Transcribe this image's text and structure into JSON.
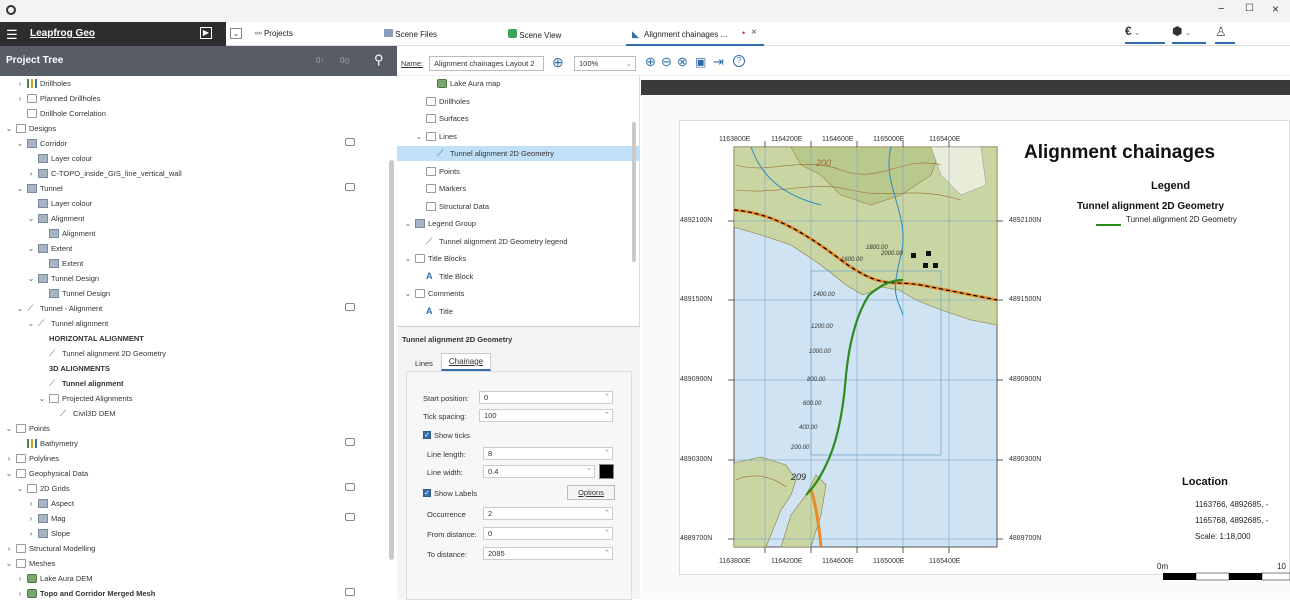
{
  "window": {
    "minimize": "−",
    "maximize": "☐",
    "close": "×"
  },
  "app": {
    "name": "Leapfrog Geo"
  },
  "tabs": [
    {
      "label": "Projects"
    },
    {
      "label": "Scene Files"
    },
    {
      "label": "Scene View"
    },
    {
      "label": "Alignment chainages ...",
      "close": "×"
    }
  ],
  "project_tree": {
    "title": "Project Tree",
    "counter_a": "0↑",
    "counter_b": "0⦅⦆",
    "rows": [
      {
        "label": "Drillholes",
        "indent": 1,
        "chev": "›",
        "icon": "drill"
      },
      {
        "label": "Planned Drillholes",
        "indent": 1,
        "chev": "›",
        "icon": "folder"
      },
      {
        "label": "Drillhole Correlation",
        "indent": 1,
        "chev": "",
        "icon": "folder"
      },
      {
        "label": "Designs",
        "indent": 0,
        "chev": "⌄",
        "icon": "folder"
      },
      {
        "label": "Corridor",
        "indent": 1,
        "chev": "⌄",
        "icon": "grid",
        "comment": true
      },
      {
        "label": "Layer colour",
        "indent": 2,
        "chev": "",
        "icon": "grid"
      },
      {
        "label": "C-TOPO_inside_GIS_line_vertical_wall",
        "indent": 2,
        "chev": "›",
        "icon": "grid"
      },
      {
        "label": "Tunnel",
        "indent": 1,
        "chev": "⌄",
        "icon": "grid",
        "comment": true
      },
      {
        "label": "Layer colour",
        "indent": 2,
        "chev": "",
        "icon": "grid"
      },
      {
        "label": "Alignment",
        "indent": 2,
        "chev": "⌄",
        "icon": "grid"
      },
      {
        "label": "Alignment",
        "indent": 3,
        "chev": "",
        "icon": "grid"
      },
      {
        "label": "Extent",
        "indent": 2,
        "chev": "⌄",
        "icon": "grid"
      },
      {
        "label": "Extent",
        "indent": 3,
        "chev": "",
        "icon": "grid"
      },
      {
        "label": "Tunnel Design",
        "indent": 2,
        "chev": "⌄",
        "icon": "grid"
      },
      {
        "label": "Tunnel Design",
        "indent": 3,
        "chev": "",
        "icon": "grid"
      },
      {
        "label": "Tunnel - Alignment",
        "indent": 1,
        "chev": "⌄",
        "icon": "align",
        "comment": true
      },
      {
        "label": "Tunnel alignment",
        "indent": 2,
        "chev": "⌄",
        "icon": "align"
      },
      {
        "label": "HORIZONTAL ALIGNMENT",
        "indent": 3,
        "chev": "",
        "icon": "",
        "bold": true
      },
      {
        "label": "Tunnel alignment 2D Geometry",
        "indent": 3,
        "chev": "",
        "icon": "align"
      },
      {
        "label": "3D ALIGNMENTS",
        "indent": 3,
        "chev": "",
        "icon": "",
        "bold": true
      },
      {
        "label": "Tunnel alignment",
        "indent": 3,
        "chev": "",
        "icon": "align",
        "bold": true
      },
      {
        "label": "Projected Alignments",
        "indent": 3,
        "chev": "⌄",
        "icon": "folder"
      },
      {
        "label": "Civil3D DEM",
        "indent": 4,
        "chev": "",
        "icon": "align"
      },
      {
        "label": "Points",
        "indent": 0,
        "chev": "⌄",
        "icon": "folder"
      },
      {
        "label": "Bathymetry",
        "indent": 1,
        "chev": "",
        "icon": "drill",
        "comment": true
      },
      {
        "label": "Polylines",
        "indent": 0,
        "chev": "›",
        "icon": "folder"
      },
      {
        "label": "Geophysical Data",
        "indent": 0,
        "chev": "⌄",
        "icon": "folder"
      },
      {
        "label": "2D Grids",
        "indent": 1,
        "chev": "⌄",
        "icon": "folder",
        "comment": true
      },
      {
        "label": "Aspect",
        "indent": 2,
        "chev": "›",
        "icon": "grid"
      },
      {
        "label": "Mag",
        "indent": 2,
        "chev": "›",
        "icon": "grid",
        "comment": true
      },
      {
        "label": "Slope",
        "indent": 2,
        "chev": "›",
        "icon": "grid"
      },
      {
        "label": "Structural Modelling",
        "indent": 0,
        "chev": "›",
        "icon": "folder"
      },
      {
        "label": "Meshes",
        "indent": 0,
        "chev": "⌄",
        "icon": "folder"
      },
      {
        "label": "Lake Aura DEM",
        "indent": 1,
        "chev": "›",
        "icon": "mesh"
      },
      {
        "label": "Topo and Corridor Merged Mesh",
        "indent": 1,
        "chev": "›",
        "icon": "mesh",
        "bold": true,
        "comment": true
      }
    ]
  },
  "editor": {
    "name_label": "Name:",
    "name_value": "Alignment chainages Layout 2",
    "zoom": "100%"
  },
  "outline": {
    "rows": [
      {
        "label": "Lake Aura map",
        "indent": 2,
        "chev": "",
        "icon": "mesh"
      },
      {
        "label": "Drillholes",
        "indent": 1,
        "chev": "",
        "icon": "folder"
      },
      {
        "label": "Surfaces",
        "indent": 1,
        "chev": "",
        "icon": "folder"
      },
      {
        "label": "Lines",
        "indent": 1,
        "chev": "⌄",
        "icon": "folder"
      },
      {
        "label": "Tunnel alignment 2D Geometry",
        "indent": 2,
        "chev": "",
        "icon": "align",
        "selected": true
      },
      {
        "label": "Points",
        "indent": 1,
        "chev": "",
        "icon": "folder"
      },
      {
        "label": "Markers",
        "indent": 1,
        "chev": "",
        "icon": "folder"
      },
      {
        "label": "Structural Data",
        "indent": 1,
        "chev": "",
        "icon": "folder"
      },
      {
        "label": "Legend Group",
        "indent": 0,
        "chev": "⌄",
        "icon": "grid"
      },
      {
        "label": "Tunnel alignment 2D Geometry legend",
        "indent": 1,
        "chev": "",
        "icon": "align"
      },
      {
        "label": "Title Blocks",
        "indent": 0,
        "chev": "⌄",
        "icon": "folder"
      },
      {
        "label": "Title Block",
        "indent": 1,
        "chev": "",
        "icon": "title"
      },
      {
        "label": "Comments",
        "indent": 0,
        "chev": "⌄",
        "icon": "folder"
      },
      {
        "label": "Title",
        "indent": 1,
        "chev": "",
        "icon": "title"
      }
    ]
  },
  "props": {
    "title": "Tunnel alignment 2D Geometry",
    "tab_lines": "Lines",
    "tab_chainage": "Chainage",
    "start_position_label": "Start position:",
    "start_position": "0",
    "tick_spacing_label": "Tick spacing:",
    "tick_spacing": "100",
    "show_ticks": "Show ticks",
    "line_length_label": "Line length:",
    "line_length": "8",
    "line_width_label": "Line width:",
    "line_width": "0.4",
    "show_labels": "Show Labels",
    "options": "Options",
    "occurrence_label": "Occurrence",
    "occurrence": "2",
    "from_distance_label": "From distance:",
    "from_distance": "0",
    "to_distance_label": "To distance:",
    "to_distance": "2085"
  },
  "map": {
    "title": "Alignment chainages",
    "legend_title": "Legend",
    "legend_group": "Tunnel alignment 2D Geometry",
    "legend_item": "Tunnel alignment 2D Geometry",
    "location_title": "Location",
    "location_line1": "1163766, 4892685, -",
    "location_line2": "1165768, 4892685, -",
    "scale": "Scale: 1:18,000",
    "scalebar_start": "0m",
    "scalebar_end": "10",
    "easting_labels": [
      "1163800E",
      "1164200E",
      "1164600E",
      "1165000E",
      "1165400E"
    ],
    "northing_labels": [
      "4892100N",
      "4891500N",
      "4890900N",
      "4890300N",
      "4889700N"
    ],
    "contour_labels": [
      "200",
      "209"
    ],
    "chainage_labels": [
      "1400.00",
      "1200.00",
      "1000.00",
      "800.00",
      "600.00",
      "400.00",
      "200.00",
      "1600.00",
      "1800.00",
      "2000.00"
    ],
    "colors": {
      "water": "#cfe3f2",
      "land": "#c9d6a3",
      "highland": "#b9c98d",
      "road": "#e8892a",
      "alignment": "#2e8b1e"
    }
  }
}
